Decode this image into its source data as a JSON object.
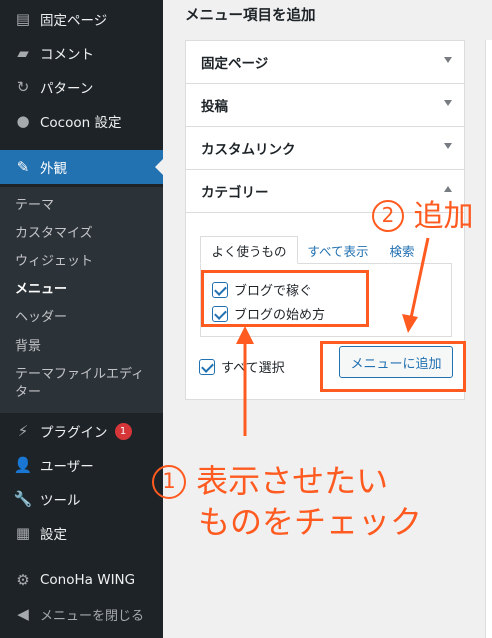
{
  "sidebar": {
    "items": [
      {
        "label": "固定ページ",
        "icon": "pages-icon"
      },
      {
        "label": "コメント",
        "icon": "comment-icon"
      },
      {
        "label": "パターン",
        "icon": "patterns-icon"
      },
      {
        "label": "Cocoon 設定",
        "icon": "cocoon-icon"
      },
      {
        "label": "外観",
        "icon": "appearance-brush-icon"
      },
      {
        "label": "プラグイン",
        "icon": "plugins-icon",
        "badge": "1"
      },
      {
        "label": "ユーザー",
        "icon": "users-icon"
      },
      {
        "label": "ツール",
        "icon": "tools-wrench-icon"
      },
      {
        "label": "設定",
        "icon": "settings-icon"
      },
      {
        "label": "ConoHa WING",
        "icon": "gear-icon"
      },
      {
        "label": "メニューを閉じる",
        "icon": "collapse-arrow-icon"
      }
    ],
    "submenu": [
      "テーマ",
      "カスタマイズ",
      "ウィジェット",
      "メニュー",
      "ヘッダー",
      "背景",
      "テーマファイルエディ",
      "ター"
    ]
  },
  "main": {
    "title": "メニュー項目を追加",
    "accordion": [
      "固定ページ",
      "投稿",
      "カスタムリンク",
      "カテゴリー"
    ],
    "tabs": [
      "よく使うもの",
      "すべて表示",
      "検索"
    ],
    "checkboxes": [
      "ブログで稼ぐ",
      "ブログの始め方"
    ],
    "select_all": "すべて選択",
    "add_button": "メニューに追加"
  },
  "annotations": {
    "step1_num": "1",
    "step1_line1": "表示させたい",
    "step1_line2": "ものをチェック",
    "step2_num": "2",
    "step2_text": "追加",
    "color": "#ff5a1f"
  },
  "colors": {
    "sidebar_bg": "#1d2327",
    "accent": "#2271b1",
    "badge": "#d63638"
  }
}
